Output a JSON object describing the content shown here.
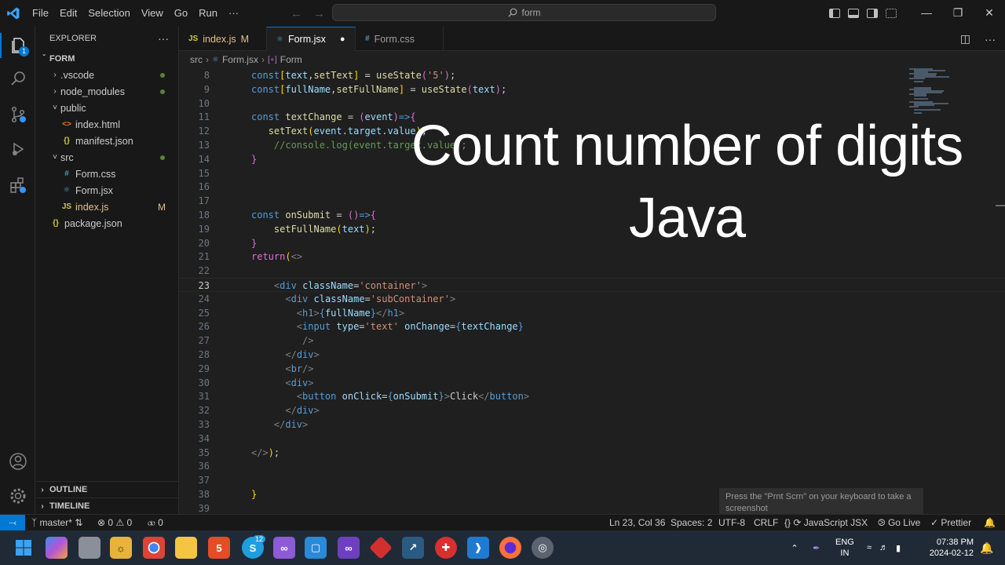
{
  "titlebar": {
    "menu": [
      "File",
      "Edit",
      "Selection",
      "View",
      "Go",
      "Run",
      "···"
    ],
    "search_text": "form",
    "window_controls": [
      "—",
      "❐",
      "✕"
    ]
  },
  "activity": {
    "explorer_badge": "1"
  },
  "sidebar": {
    "header": "EXPLORER",
    "more": "···",
    "folder": "FORM",
    "items": [
      {
        "name": ".vscode",
        "chev": "›",
        "icon": "",
        "status": "dot",
        "indent": 18
      },
      {
        "name": "node_modules",
        "chev": "›",
        "icon": "",
        "status": "dot",
        "indent": 18
      },
      {
        "name": "public",
        "chev": "˅",
        "icon": "",
        "status": "",
        "indent": 18
      },
      {
        "name": "index.html",
        "chev": "",
        "icon": "<>",
        "icon_color": "#e37933",
        "status": "",
        "indent": 32
      },
      {
        "name": "manifest.json",
        "chev": "",
        "icon": "{}",
        "icon_color": "#cbcb41",
        "status": "",
        "indent": 32
      },
      {
        "name": "src",
        "chev": "˅",
        "icon": "",
        "status": "dot",
        "indent": 18
      },
      {
        "name": "Form.css",
        "chev": "",
        "icon": "#",
        "icon_color": "#519aba",
        "status": "",
        "indent": 32
      },
      {
        "name": "Form.jsx",
        "chev": "",
        "icon": "⚛",
        "icon_color": "#519aba",
        "status": "",
        "indent": 32
      },
      {
        "name": "index.js",
        "chev": "",
        "icon": "JS",
        "icon_color": "#cbcb41",
        "status": "M",
        "indent": 32
      },
      {
        "name": "package.json",
        "chev": "",
        "icon": "{}",
        "icon_color": "#cbcb41",
        "status": "",
        "indent": 18
      }
    ],
    "outline": "OUTLINE",
    "timeline": "TIMELINE"
  },
  "tabs": [
    {
      "label": "index.js",
      "icon": "JS",
      "icon_color": "#cbcb41",
      "suffix": "M",
      "active": false
    },
    {
      "label": "Form.jsx",
      "icon": "⚛",
      "icon_color": "#519aba",
      "suffix": "●",
      "active": true
    },
    {
      "label": "Form.css",
      "icon": "#",
      "icon_color": "#519aba",
      "suffix": "",
      "active": false
    }
  ],
  "breadcrumb": [
    "src",
    "Form.jsx",
    "Form"
  ],
  "code": {
    "current_line": "23",
    "lines": [
      {
        "n": "8",
        "html": "<span class='k'>const</span><span class='b'>[</span><span class='v'>text</span>,<span class='f'>setText</span><span class='b'>]</span> = <span class='f'>useState</span><span class='p'>(</span><span class='s'>'5'</span><span class='p'>)</span>;"
      },
      {
        "n": "9",
        "html": "<span class='k'>const</span><span class='b'>[</span><span class='v'>fullName</span>,<span class='f'>setFullName</span><span class='b'>]</span> = <span class='f'>useState</span><span class='p'>(</span><span class='v'>text</span><span class='p'>)</span>;"
      },
      {
        "n": "10",
        "html": ""
      },
      {
        "n": "11",
        "html": "<span class='k'>const</span> <span class='f'>textChange</span> = <span class='p'>(</span><span class='v'>event</span><span class='p'>)</span><span class='k'>=&gt;</span><span class='p'>{</span>"
      },
      {
        "n": "12",
        "html": "   <span class='f'>setText</span><span class='b'>(</span><span class='v'>event</span>.<span class='v'>target</span>.<span class='v'>value</span><span class='b'>)</span>;"
      },
      {
        "n": "13",
        "html": "    <span class='c'>//console.log(event.target.value);</span>"
      },
      {
        "n": "14",
        "html": "<span class='p'>}</span>"
      },
      {
        "n": "15",
        "html": ""
      },
      {
        "n": "16",
        "html": ""
      },
      {
        "n": "17",
        "html": ""
      },
      {
        "n": "18",
        "html": "<span class='k'>const</span> <span class='f'>onSubmit</span> = <span class='p'>()</span><span class='k'>=&gt;</span><span class='p'>{</span>"
      },
      {
        "n": "19",
        "html": "    <span class='f'>setFullName</span><span class='b'>(</span><span class='v'>text</span><span class='b'>)</span>;"
      },
      {
        "n": "20",
        "html": "<span class='p'>}</span>"
      },
      {
        "n": "21",
        "html": "<span class='p'>return</span><span class='b'>(</span><span class='t'>&lt;&gt;</span>"
      },
      {
        "n": "22",
        "html": ""
      },
      {
        "n": "23",
        "html": "    <span class='t'>&lt;</span><span class='tg'>div</span> <span class='at'>className</span>=<span class='s'>'container'</span><span class='t'>&gt;</span>"
      },
      {
        "n": "24",
        "html": "      <span class='t'>&lt;</span><span class='tg'>div</span> <span class='at'>className</span>=<span class='s'>'subContainer'</span><span class='t'>&gt;</span>"
      },
      {
        "n": "25",
        "html": "        <span class='t'>&lt;</span><span class='tg'>h1</span><span class='t'>&gt;</span><span class='k'>{</span><span class='v'>fullName</span><span class='k'>}</span><span class='t'>&lt;/</span><span class='tg'>h1</span><span class='t'>&gt;</span>"
      },
      {
        "n": "26",
        "html": "        <span class='t'>&lt;</span><span class='tg'>input</span> <span class='at'>type</span>=<span class='s'>'text'</span> <span class='at'>onChange</span>=<span class='k'>{</span><span class='v'>textChange</span><span class='k'>}</span>"
      },
      {
        "n": "27",
        "html": "         <span class='t'>/&gt;</span>"
      },
      {
        "n": "28",
        "html": "      <span class='t'>&lt;/</span><span class='tg'>div</span><span class='t'>&gt;</span>"
      },
      {
        "n": "29",
        "html": "      <span class='t'>&lt;</span><span class='tg'>br</span><span class='t'>/&gt;</span>"
      },
      {
        "n": "30",
        "html": "      <span class='t'>&lt;</span><span class='tg'>div</span><span class='t'>&gt;</span>"
      },
      {
        "n": "31",
        "html": "        <span class='t'>&lt;</span><span class='tg'>button</span> <span class='at'>onClick</span>=<span class='k'>{</span><span class='v'>onSubmit</span><span class='k'>}</span><span class='t'>&gt;</span>Click<span class='t'>&lt;/</span><span class='tg'>button</span><span class='t'>&gt;</span>"
      },
      {
        "n": "32",
        "html": "      <span class='t'>&lt;/</span><span class='tg'>div</span><span class='t'>&gt;</span>"
      },
      {
        "n": "33",
        "html": "    <span class='t'>&lt;/</span><span class='tg'>div</span><span class='t'>&gt;</span>"
      },
      {
        "n": "34",
        "html": ""
      },
      {
        "n": "35",
        "html": "<span class='t'>&lt;/&gt;</span><span class='b'>)</span>;"
      },
      {
        "n": "36",
        "html": ""
      },
      {
        "n": "37",
        "html": ""
      },
      {
        "n": "38",
        "html": "<span class='b'>}</span>"
      },
      {
        "n": "39",
        "html": ""
      }
    ]
  },
  "overlay": {
    "line1": "Count number of digits",
    "line2": "Java"
  },
  "toast": "Press the \"Prnt Scrn\" on your keyboard to take a screenshot",
  "statusbar": {
    "branch": "master*",
    "errors": "0",
    "warnings": "0",
    "ports": "0",
    "position": "Ln 23, Col 36",
    "spaces": "Spaces: 2",
    "encoding": "UTF-8",
    "eol": "CRLF",
    "language": "JavaScript JSX",
    "golive": "Go Live",
    "prettier": "Prettier"
  },
  "taskbar": {
    "lang1": "ENG",
    "lang2": "IN",
    "time": "07:38 PM",
    "date": "2024-02-12",
    "skype_badge": "12"
  }
}
